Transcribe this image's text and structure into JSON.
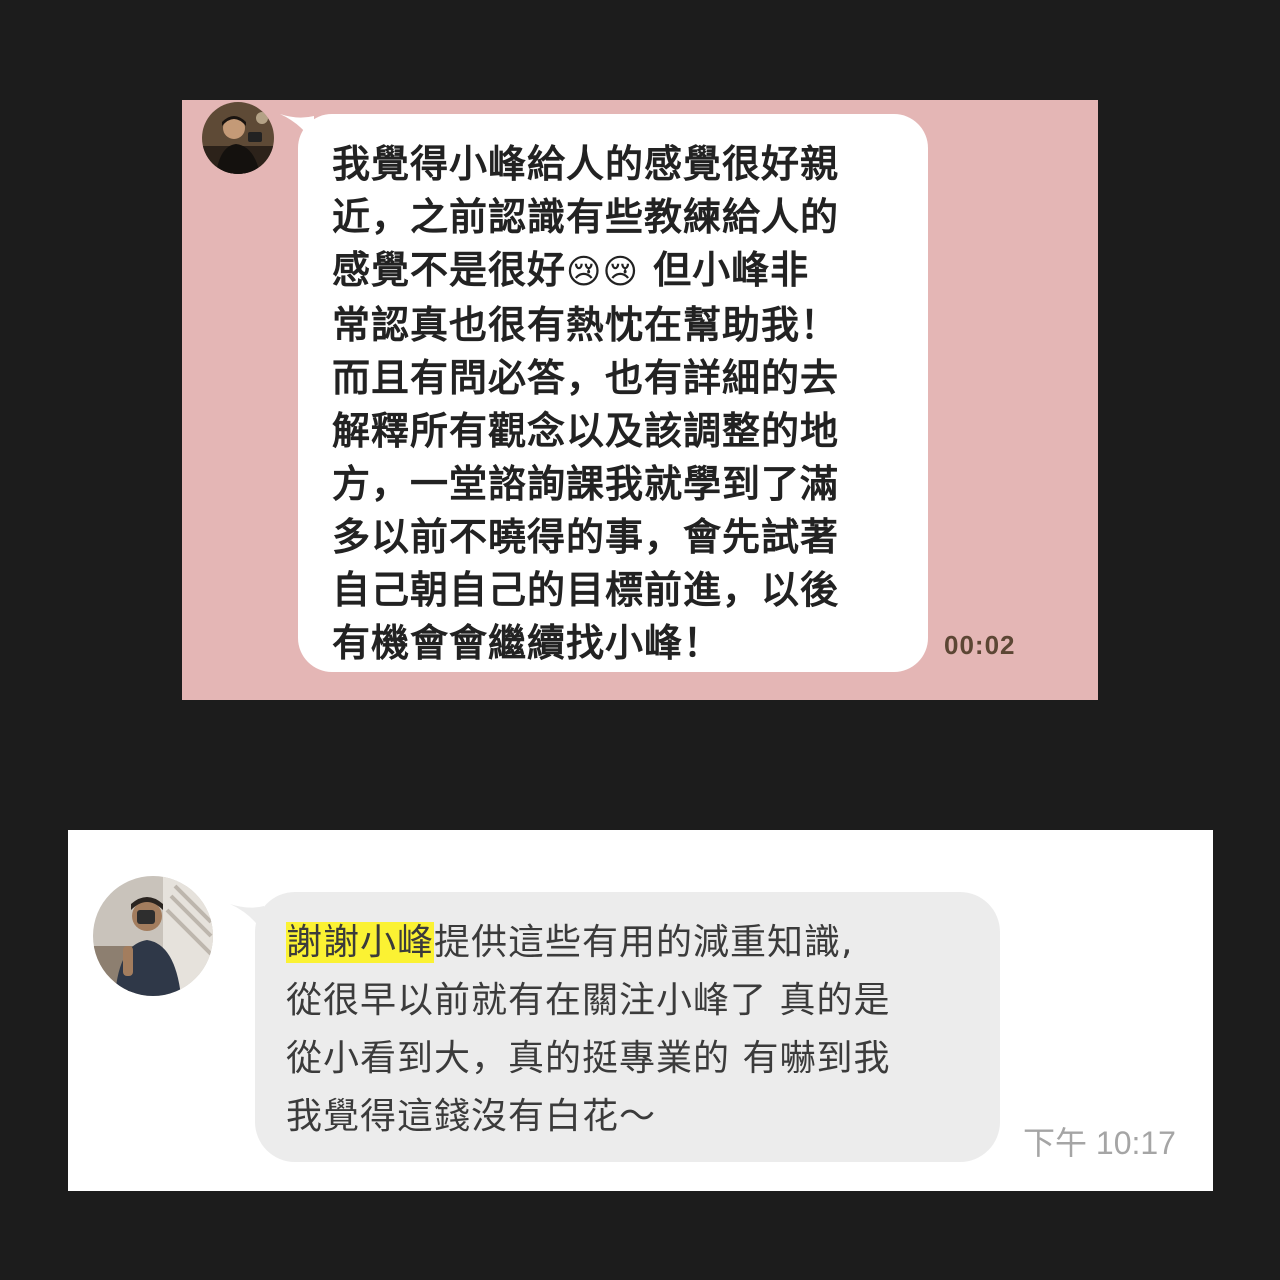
{
  "chat_1": {
    "message_lines": [
      "我覺得小峰給人的感覺很好親",
      "近，之前認識有些教練給人的",
      "感覺不是很好",
      "但小峰非",
      "常認真也很有熱忱在幫助我！",
      "而且有問必答，也有詳細的去",
      "解釋所有觀念以及該調整的地",
      "方，一堂諮詢課我就學到了滿",
      "多以前不曉得的事，會先試著",
      "自己朝自己的目標前進，以後",
      "有機會會繼續找小峰！"
    ],
    "emoji": "😢",
    "timestamp": "00:02"
  },
  "chat_2": {
    "message_lines": [
      "謝謝小峰",
      "提供這些有用的減重知識,",
      "從很早以前就有在關注小峰了 真的是",
      "從小看到大，真的挺專業的 有嚇到我",
      "我覺得這錢沒有白花～"
    ],
    "timestamp": "下午 10:17"
  },
  "colors": {
    "page_background": "#1c1c1c",
    "panel_1_background": "#e4b6b5",
    "bubble_1": "#ffffff",
    "panel_2_background": "#ffffff",
    "bubble_2": "#ececec",
    "highlight": "#fbf233"
  },
  "icons": {
    "avatar_1": "user-avatar-photo",
    "avatar_2": "user-avatar-photo",
    "emoji": "crying-face-emoji"
  }
}
